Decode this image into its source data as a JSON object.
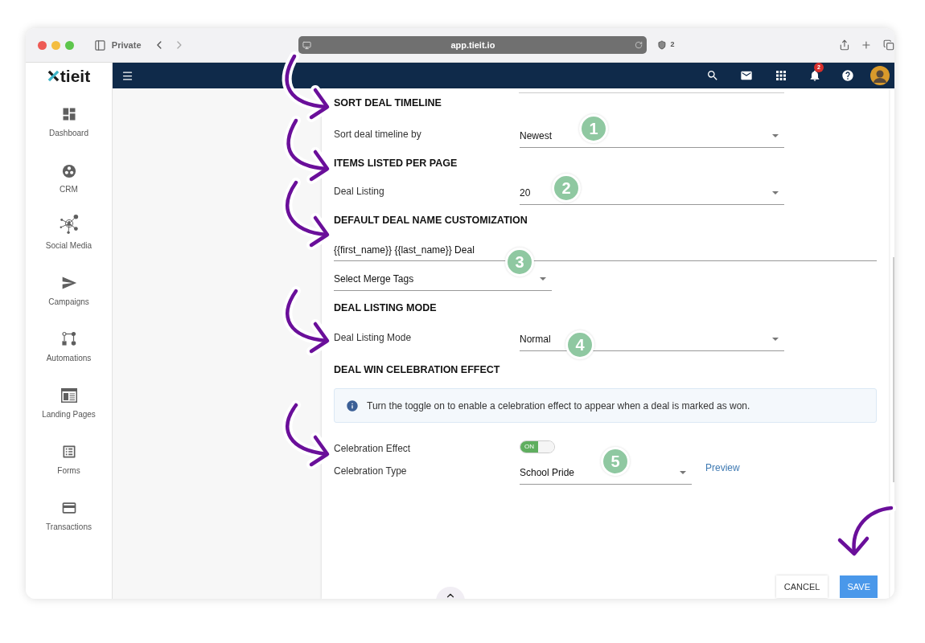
{
  "browser": {
    "private_label": "Private",
    "url": "app.tieit.io",
    "shield_count": "2"
  },
  "logo": {
    "text": "tieit"
  },
  "navbar": {
    "notification_count": "2"
  },
  "sidebar": {
    "items": [
      {
        "label": "Dashboard",
        "kind": "dashboard"
      },
      {
        "label": "CRM",
        "kind": "crm"
      },
      {
        "label": "Social Media",
        "kind": "social"
      },
      {
        "label": "Campaigns",
        "kind": "campaigns"
      },
      {
        "label": "Automations",
        "kind": "automations"
      },
      {
        "label": "Landing Pages",
        "kind": "landing"
      },
      {
        "label": "Forms",
        "kind": "forms"
      },
      {
        "label": "Transactions",
        "kind": "transactions"
      }
    ]
  },
  "sections": [
    {
      "title": "SORT DEAL TIMELINE",
      "fields": [
        {
          "kind": "select",
          "label": "Sort deal timeline by",
          "value": "Newest"
        }
      ]
    },
    {
      "title": "ITEMS LISTED PER PAGE",
      "fields": [
        {
          "kind": "select",
          "label": "Deal Listing",
          "value": "20"
        }
      ]
    },
    {
      "title": "DEFAULT DEAL NAME CUSTOMIZATION",
      "fields": [
        {
          "kind": "text",
          "value": "{{first_name}} {{last_name}} Deal"
        },
        {
          "kind": "tags",
          "value": "Select Merge Tags"
        }
      ]
    },
    {
      "title": "DEAL LISTING MODE",
      "fields": [
        {
          "kind": "select",
          "label": "Deal Listing Mode",
          "value": "Normal"
        }
      ]
    },
    {
      "title": "DEAL WIN CELEBRATION EFFECT",
      "fields": [
        {
          "kind": "info",
          "text": "Turn the toggle on to enable a celebration effect to appear when a deal is marked as won."
        },
        {
          "kind": "toggle",
          "label": "Celebration Effect",
          "on": true,
          "toggle_text": "ON"
        },
        {
          "kind": "select_link",
          "label": "Celebration Type",
          "value": "School Pride",
          "link": "Preview"
        }
      ]
    }
  ],
  "actions": {
    "cancel": "CANCEL",
    "save": "SAVE"
  },
  "callouts": [
    {
      "number": "1"
    },
    {
      "number": "2"
    },
    {
      "number": "3"
    },
    {
      "number": "4"
    },
    {
      "number": "5"
    }
  ]
}
